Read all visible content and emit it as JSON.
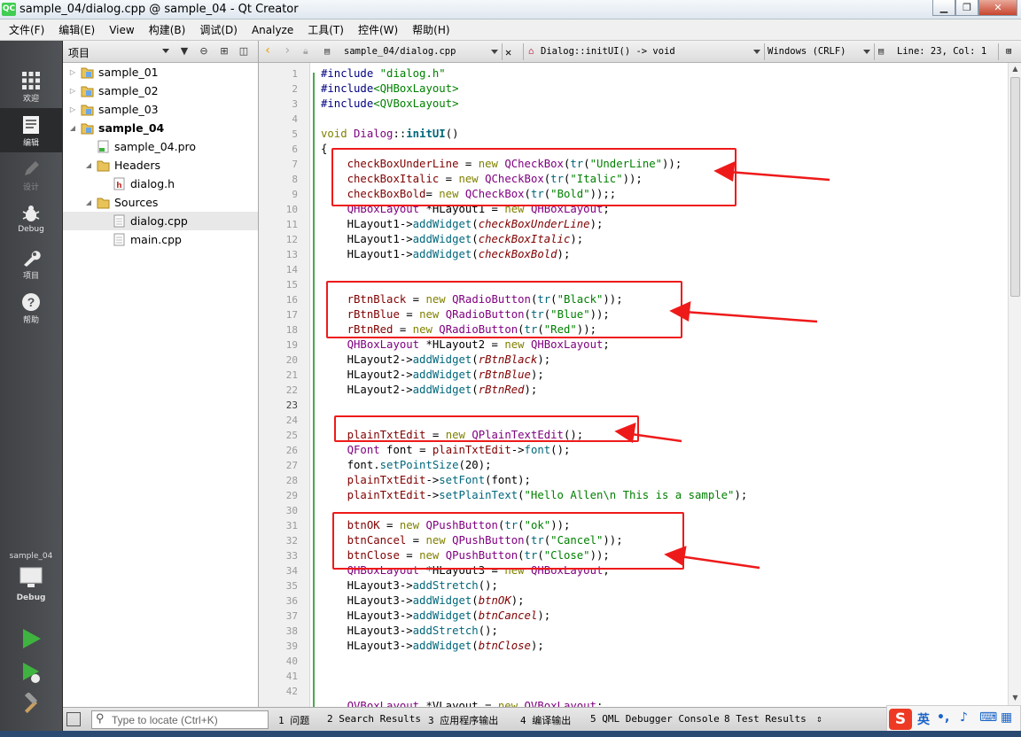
{
  "window": {
    "title": "sample_04/dialog.cpp @ sample_04 - Qt Creator",
    "app_icon_text": "QC"
  },
  "menu": [
    "文件(F)",
    "编辑(E)",
    "View",
    "构建(B)",
    "调试(D)",
    "Analyze",
    "工具(T)",
    "控件(W)",
    "帮助(H)"
  ],
  "modes": [
    {
      "label": "欢迎",
      "icon": "grid-icon"
    },
    {
      "label": "编辑",
      "icon": "edit-icon"
    },
    {
      "label": "设计",
      "icon": "pen-icon"
    },
    {
      "label": "Debug",
      "icon": "bug-icon"
    },
    {
      "label": "项目",
      "icon": "wrench-icon"
    },
    {
      "label": "帮助",
      "icon": "help-icon"
    }
  ],
  "kit": {
    "project": "sample_04",
    "config": "Debug"
  },
  "project_panel": {
    "title": "项目",
    "tree": [
      {
        "label": "sample_01",
        "type": "project",
        "level": 0,
        "bold": false,
        "expanded": false
      },
      {
        "label": "sample_02",
        "type": "project",
        "level": 0,
        "bold": false,
        "expanded": false
      },
      {
        "label": "sample_03",
        "type": "project",
        "level": 0,
        "bold": false,
        "expanded": false
      },
      {
        "label": "sample_04",
        "type": "project",
        "level": 0,
        "bold": true,
        "expanded": true
      },
      {
        "label": "sample_04.pro",
        "type": "pro",
        "level": 1
      },
      {
        "label": "Headers",
        "type": "folder",
        "level": 1,
        "expanded": true
      },
      {
        "label": "dialog.h",
        "type": "header",
        "level": 2
      },
      {
        "label": "Sources",
        "type": "folder",
        "level": 1,
        "expanded": true
      },
      {
        "label": "dialog.cpp",
        "type": "source",
        "level": 2,
        "selected": true
      },
      {
        "label": "main.cpp",
        "type": "source",
        "level": 2
      }
    ]
  },
  "editor_toolbar": {
    "file": "sample_04/dialog.cpp",
    "symbol": "Dialog::initUI() -> void",
    "line_ending": "Windows (CRLF)",
    "position": "Line: 23, Col: 1"
  },
  "editor": {
    "current_line": 23,
    "line_numbers": [
      "1",
      "2",
      "3",
      "4",
      "5",
      "6",
      "7",
      "8",
      "9",
      "10",
      "11",
      "12",
      "13",
      "14",
      "15",
      "16",
      "17",
      "18",
      "19",
      "20",
      "21",
      "22",
      "23",
      "24",
      "25",
      "26",
      "27",
      "28",
      "29",
      "30",
      "31",
      "32",
      "33",
      "34",
      "35",
      "36",
      "37",
      "38",
      "39",
      "40",
      "41",
      "42"
    ],
    "lines": [
      [
        [
          "pre",
          "#include "
        ],
        [
          "str",
          "\"dialog.h\""
        ]
      ],
      [
        [
          "pre",
          "#include"
        ],
        [
          "str",
          "<QHBoxLayout>"
        ]
      ],
      [
        [
          "pre",
          "#include"
        ],
        [
          "str",
          "<QVBoxLayout>"
        ]
      ],
      [],
      [
        [
          "kw",
          "void "
        ],
        [
          "cls",
          "Dialog"
        ],
        [
          "",
          "::"
        ],
        [
          "fnb",
          "initUI"
        ],
        [
          "",
          "()"
        ]
      ],
      [
        [
          "",
          "{"
        ]
      ],
      [
        [
          "",
          "    "
        ],
        [
          "var",
          "checkBoxUnderLine"
        ],
        [
          "",
          " = "
        ],
        [
          "kw",
          "new "
        ],
        [
          "cls",
          "QCheckBox"
        ],
        [
          "",
          "("
        ],
        [
          "fn",
          "tr"
        ],
        [
          "",
          "("
        ],
        [
          "str",
          "\"UnderLine\""
        ],
        [
          "",
          "));"
        ]
      ],
      [
        [
          "",
          "    "
        ],
        [
          "var",
          "checkBoxItalic"
        ],
        [
          "",
          " = "
        ],
        [
          "kw",
          "new "
        ],
        [
          "cls",
          "QCheckBox"
        ],
        [
          "",
          "("
        ],
        [
          "fn",
          "tr"
        ],
        [
          "",
          "("
        ],
        [
          "str",
          "\"Italic\""
        ],
        [
          "",
          "));"
        ]
      ],
      [
        [
          "",
          "    "
        ],
        [
          "var",
          "checkBoxBold"
        ],
        [
          "",
          "= "
        ],
        [
          "kw",
          "new "
        ],
        [
          "cls",
          "QCheckBox"
        ],
        [
          "",
          "("
        ],
        [
          "fn",
          "tr"
        ],
        [
          "",
          "("
        ],
        [
          "str",
          "\"Bold\""
        ],
        [
          "",
          "));;"
        ]
      ],
      [
        [
          "",
          "    "
        ],
        [
          "cls",
          "QHBoxLayout"
        ],
        [
          "",
          " *HLayout1 = "
        ],
        [
          "kw",
          "new "
        ],
        [
          "cls",
          "QHBoxLayout"
        ],
        [
          "",
          ";"
        ]
      ],
      [
        [
          "",
          "    HLayout1->"
        ],
        [
          "fn",
          "addWidget"
        ],
        [
          "",
          "("
        ],
        [
          "ivar",
          "checkBoxUnderLine"
        ],
        [
          "",
          ");"
        ]
      ],
      [
        [
          "",
          "    HLayout1->"
        ],
        [
          "fn",
          "addWidget"
        ],
        [
          "",
          "("
        ],
        [
          "ivar",
          "checkBoxItalic"
        ],
        [
          "",
          ");"
        ]
      ],
      [
        [
          "",
          "    HLayout1->"
        ],
        [
          "fn",
          "addWidget"
        ],
        [
          "",
          "("
        ],
        [
          "ivar",
          "checkBoxBold"
        ],
        [
          "",
          ");"
        ]
      ],
      [],
      [],
      [
        [
          "",
          "    "
        ],
        [
          "var",
          "rBtnBlack"
        ],
        [
          "",
          " = "
        ],
        [
          "kw",
          "new "
        ],
        [
          "cls",
          "QRadioButton"
        ],
        [
          "",
          "("
        ],
        [
          "fn",
          "tr"
        ],
        [
          "",
          "("
        ],
        [
          "str",
          "\"Black\""
        ],
        [
          "",
          "));"
        ]
      ],
      [
        [
          "",
          "    "
        ],
        [
          "var",
          "rBtnBlue"
        ],
        [
          "",
          " = "
        ],
        [
          "kw",
          "new "
        ],
        [
          "cls",
          "QRadioButton"
        ],
        [
          "",
          "("
        ],
        [
          "fn",
          "tr"
        ],
        [
          "",
          "("
        ],
        [
          "str",
          "\"Blue\""
        ],
        [
          "",
          "));"
        ]
      ],
      [
        [
          "",
          "    "
        ],
        [
          "var",
          "rBtnRed"
        ],
        [
          "",
          " = "
        ],
        [
          "kw",
          "new "
        ],
        [
          "cls",
          "QRadioButton"
        ],
        [
          "",
          "("
        ],
        [
          "fn",
          "tr"
        ],
        [
          "",
          "("
        ],
        [
          "str",
          "\"Red\""
        ],
        [
          "",
          "));"
        ]
      ],
      [
        [
          "",
          "    "
        ],
        [
          "cls",
          "QHBoxLayout"
        ],
        [
          "",
          " *HLayout2 = "
        ],
        [
          "kw",
          "new "
        ],
        [
          "cls",
          "QHBoxLayout"
        ],
        [
          "",
          ";"
        ]
      ],
      [
        [
          "",
          "    HLayout2->"
        ],
        [
          "fn",
          "addWidget"
        ],
        [
          "",
          "("
        ],
        [
          "ivar",
          "rBtnBlack"
        ],
        [
          "",
          ");"
        ]
      ],
      [
        [
          "",
          "    HLayout2->"
        ],
        [
          "fn",
          "addWidget"
        ],
        [
          "",
          "("
        ],
        [
          "ivar",
          "rBtnBlue"
        ],
        [
          "",
          ");"
        ]
      ],
      [
        [
          "",
          "    HLayout2->"
        ],
        [
          "fn",
          "addWidget"
        ],
        [
          "",
          "("
        ],
        [
          "ivar",
          "rBtnRed"
        ],
        [
          "",
          ");"
        ]
      ],
      [],
      [],
      [
        [
          "",
          "    "
        ],
        [
          "var",
          "plainTxtEdit"
        ],
        [
          "",
          " = "
        ],
        [
          "kw",
          "new "
        ],
        [
          "cls",
          "QPlainTextEdit"
        ],
        [
          "",
          "();"
        ]
      ],
      [
        [
          "",
          "    "
        ],
        [
          "cls",
          "QFont"
        ],
        [
          "",
          " font = "
        ],
        [
          "var",
          "plainTxtEdit"
        ],
        [
          "",
          "->"
        ],
        [
          "fn",
          "font"
        ],
        [
          "",
          "();"
        ]
      ],
      [
        [
          "",
          "    font."
        ],
        [
          "fn",
          "setPointSize"
        ],
        [
          "",
          "(20);"
        ]
      ],
      [
        [
          "",
          "    "
        ],
        [
          "var",
          "plainTxtEdit"
        ],
        [
          "",
          "->"
        ],
        [
          "fn",
          "setFont"
        ],
        [
          "",
          "(font);"
        ]
      ],
      [
        [
          "",
          "    "
        ],
        [
          "var",
          "plainTxtEdit"
        ],
        [
          "",
          "->"
        ],
        [
          "fn",
          "setPlainText"
        ],
        [
          "",
          "("
        ],
        [
          "str",
          "\"Hello Allen\\n This is a sample\""
        ],
        [
          "",
          ");"
        ]
      ],
      [],
      [
        [
          "",
          "    "
        ],
        [
          "var",
          "btnOK"
        ],
        [
          "",
          " = "
        ],
        [
          "kw",
          "new "
        ],
        [
          "cls",
          "QPushButton"
        ],
        [
          "",
          "("
        ],
        [
          "fn",
          "tr"
        ],
        [
          "",
          "("
        ],
        [
          "str",
          "\"ok\""
        ],
        [
          "",
          "));"
        ]
      ],
      [
        [
          "",
          "    "
        ],
        [
          "var",
          "btnCancel"
        ],
        [
          "",
          " = "
        ],
        [
          "kw",
          "new "
        ],
        [
          "cls",
          "QPushButton"
        ],
        [
          "",
          "("
        ],
        [
          "fn",
          "tr"
        ],
        [
          "",
          "("
        ],
        [
          "str",
          "\"Cancel\""
        ],
        [
          "",
          "));"
        ]
      ],
      [
        [
          "",
          "    "
        ],
        [
          "var",
          "btnClose"
        ],
        [
          "",
          " = "
        ],
        [
          "kw",
          "new "
        ],
        [
          "cls",
          "QPushButton"
        ],
        [
          "",
          "("
        ],
        [
          "fn",
          "tr"
        ],
        [
          "",
          "("
        ],
        [
          "str",
          "\"Close\""
        ],
        [
          "",
          "));"
        ]
      ],
      [
        [
          "",
          "    "
        ],
        [
          "cls",
          "QHBoxLayout"
        ],
        [
          "",
          " *HLayout3 = "
        ],
        [
          "kw",
          "new "
        ],
        [
          "cls",
          "QHBoxLayout"
        ],
        [
          "",
          ";"
        ]
      ],
      [
        [
          "",
          "    HLayout3->"
        ],
        [
          "fn",
          "addStretch"
        ],
        [
          "",
          "();"
        ]
      ],
      [
        [
          "",
          "    HLayout3->"
        ],
        [
          "fn",
          "addWidget"
        ],
        [
          "",
          "("
        ],
        [
          "ivar",
          "btnOK"
        ],
        [
          "",
          ");"
        ]
      ],
      [
        [
          "",
          "    HLayout3->"
        ],
        [
          "fn",
          "addWidget"
        ],
        [
          "",
          "("
        ],
        [
          "ivar",
          "btnCancel"
        ],
        [
          "",
          ");"
        ]
      ],
      [
        [
          "",
          "    HLayout3->"
        ],
        [
          "fn",
          "addStretch"
        ],
        [
          "",
          "();"
        ]
      ],
      [
        [
          "",
          "    HLayout3->"
        ],
        [
          "fn",
          "addWidget"
        ],
        [
          "",
          "("
        ],
        [
          "ivar",
          "btnClose"
        ],
        [
          "",
          ");"
        ]
      ],
      [],
      [],
      [],
      [
        [
          "",
          "    "
        ],
        [
          "cls",
          "QVBoxLayout"
        ],
        [
          "",
          " *VLayout = "
        ],
        [
          "kw",
          "new "
        ],
        [
          "cls",
          "QVBoxLayout"
        ],
        [
          "",
          ";"
        ]
      ]
    ]
  },
  "statusbar": {
    "locator_placeholder": "Type to locate (Ctrl+K)",
    "tabs": [
      "1 问题",
      "2 Search Results",
      "3 应用程序输出",
      "4 编译输出",
      "5 QML Debugger Console",
      "8 Test Results"
    ]
  },
  "ime": {
    "logo": "S",
    "lang": "英"
  },
  "colors": {
    "annotation": "#ee1a1a"
  }
}
